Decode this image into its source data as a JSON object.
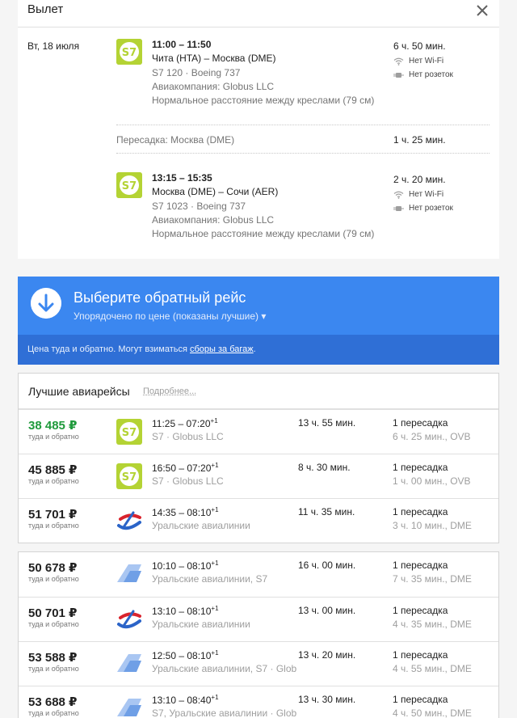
{
  "outbound": {
    "title": "Вылет",
    "date": "Вт, 18 июля",
    "segments": [
      {
        "times": "11:00 – 11:50",
        "route": "Чита (HTA) – Москва (DME)",
        "flight": "S7 120 · Boeing 737",
        "airline": "Авиакомпания: Globus LLC",
        "seat": "Нормальное расстояние между креслами (79 см)",
        "duration": "6 ч. 50 мин.",
        "wifi": "Нет Wi-Fi",
        "power": "Нет розеток"
      },
      {
        "times": "13:15 – 15:35",
        "route": "Москва (DME) – Сочи (AER)",
        "flight": "S7 1023 · Boeing 737",
        "airline": "Авиакомпания: Globus LLC",
        "seat": "Нормальное расстояние между креслами (79 см)",
        "duration": "2 ч. 20 мин.",
        "wifi": "Нет Wi-Fi",
        "power": "Нет розеток"
      }
    ],
    "layover": {
      "label": "Пересадка: Москва (DME)",
      "duration": "1 ч. 25 мин."
    }
  },
  "return_banner": {
    "title": "Выберите обратный рейс",
    "sort": "Упорядочено по цене (показаны лучшие) ▾",
    "note_prefix": "Цена туда и обратно. Могут взиматься ",
    "note_link": "сборы за багаж",
    "note_suffix": "."
  },
  "best": {
    "title": "Лучшие авиарейсы",
    "more": "Подробнее..."
  },
  "flights_best": [
    {
      "price": "38 485 ₽",
      "sub": "туда и обратно",
      "dep": "11:25 – 07:20",
      "sup": "+1",
      "airline": "S7 · Globus LLC",
      "duration": "13 ч. 55 мин.",
      "stops": "1 пересадка",
      "stopinfo": "6 ч. 25 мин., OVB",
      "logo": "s7",
      "green": true
    },
    {
      "price": "45 885 ₽",
      "sub": "туда и обратно",
      "dep": "16:50 – 07:20",
      "sup": "+1",
      "airline": "S7 · Globus LLC",
      "duration": "8 ч. 30 мин.",
      "stops": "1 пересадка",
      "stopinfo": "1 ч. 00 мин., OVB",
      "logo": "s7"
    },
    {
      "price": "51 701 ₽",
      "sub": "туда и обратно",
      "dep": "14:35 – 08:10",
      "sup": "+1",
      "airline": "Уральские авиалинии",
      "duration": "11 ч. 35 мин.",
      "stops": "1 пересадка",
      "stopinfo": "3 ч. 10 мин., DME",
      "logo": "ural"
    }
  ],
  "flights_other": [
    {
      "price": "50 678 ₽",
      "sub": "туда и обратно",
      "dep": "10:10 – 08:10",
      "sup": "+1",
      "airline": "Уральские авиалинии, S7",
      "duration": "16 ч. 00 мин.",
      "stops": "1 пересадка",
      "stopinfo": "7 ч. 35 мин., DME",
      "logo": "multi"
    },
    {
      "price": "50 701 ₽",
      "sub": "туда и обратно",
      "dep": "13:10 – 08:10",
      "sup": "+1",
      "airline": "Уральские авиалинии",
      "duration": "13 ч. 00 мин.",
      "stops": "1 пересадка",
      "stopinfo": "4 ч. 35 мин., DME",
      "logo": "ural"
    },
    {
      "price": "53 588 ₽",
      "sub": "туда и обратно",
      "dep": "12:50 – 08:10",
      "sup": "+1",
      "airline": "Уральские авиалинии, S7 · Glob",
      "duration": "13 ч. 20 мин.",
      "stops": "1 пересадка",
      "stopinfo": "4 ч. 55 мин., DME",
      "logo": "multi"
    },
    {
      "price": "53 688 ₽",
      "sub": "туда и обратно",
      "dep": "13:10 – 08:40",
      "sup": "+1",
      "airline": "S7, Уральские авиалинии · Glob",
      "duration": "13 ч. 30 мин.",
      "stops": "1 пересадка",
      "stopinfo": "4 ч. 50 мин., DME",
      "logo": "multi"
    }
  ],
  "colors": {
    "banner": "#3b87f0",
    "banner_bottom": "#2f6fd6",
    "price_best": "#1f9a3c",
    "s7_logo": "#b4d334"
  },
  "icons": {
    "close": "close-icon",
    "arrow_down": "arrow-down-icon",
    "wifi": "wifi-icon",
    "power": "power-plug-icon"
  }
}
